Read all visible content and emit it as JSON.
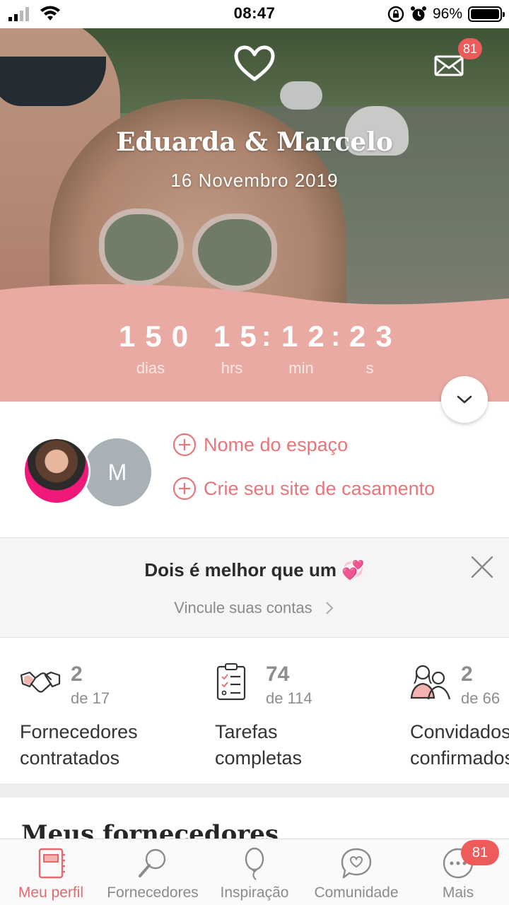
{
  "status_bar": {
    "time": "08:47",
    "battery_percent": "96%",
    "icons": [
      "signal-icon",
      "wifi-icon",
      "orientation-lock-icon",
      "alarm-icon",
      "battery-icon"
    ]
  },
  "header": {
    "couple_names": "Eduarda & Marcelo",
    "wedding_date": "16 Novembro 2019",
    "messages_badge": "81"
  },
  "countdown": {
    "days": "150",
    "days_label": "dias",
    "hours": "15",
    "hours_label": "hrs",
    "minutes": "12",
    "minutes_label": "min",
    "seconds": "23",
    "seconds_label": "s"
  },
  "profile": {
    "partner_initial": "M",
    "venue_link": "Nome do espaço",
    "website_link": "Crie seu site de casamento"
  },
  "link_accounts_banner": {
    "title": "Dois é melhor que um 💞",
    "link": "Vincule suas contas"
  },
  "stats": [
    {
      "count": "2",
      "total": "de 17",
      "label_line1": "Fornecedores",
      "label_line2": "contratados"
    },
    {
      "count": "74",
      "total": "de 114",
      "label_line1": "Tarefas",
      "label_line2": "completas"
    },
    {
      "count": "2",
      "total": "de 66",
      "label_line1": "Convidados",
      "label_line2": "confirmados"
    }
  ],
  "section": {
    "title": "Meus fornecedores"
  },
  "tabbar": {
    "tabs": [
      {
        "label": "Meu perfil",
        "icon": "notebook-icon"
      },
      {
        "label": "Fornecedores",
        "icon": "magnifier-icon"
      },
      {
        "label": "Inspiração",
        "icon": "balloon-icon"
      },
      {
        "label": "Comunidade",
        "icon": "chat-heart-icon"
      },
      {
        "label": "Mais",
        "icon": "more-dots-icon"
      }
    ],
    "more_badge": "81"
  },
  "colors": {
    "accent": "#e8757a",
    "countdown_band": "#e8aaa3",
    "badge": "#ee5b5b"
  }
}
